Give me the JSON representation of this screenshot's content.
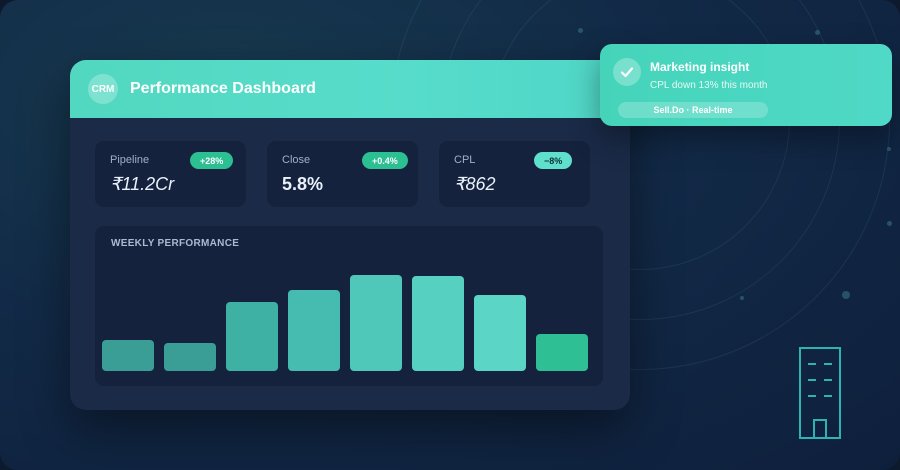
{
  "dashboard": {
    "logo_text": "CRM",
    "title": "Performance Dashboard"
  },
  "metrics": [
    {
      "label": "Pipeline",
      "value": "₹11.2Cr",
      "badge": "+28%"
    },
    {
      "label": "Close",
      "value": "5.8%",
      "badge": "+0.4%"
    },
    {
      "label": "CPL",
      "value": "₹862",
      "badge": "−8%"
    }
  ],
  "chart_data": {
    "type": "bar",
    "title": "WEEKLY PERFORMANCE",
    "categories": [
      "",
      "",
      "",
      "",
      "",
      "",
      "",
      ""
    ],
    "values": [
      31,
      28,
      69,
      81,
      96,
      95,
      76,
      37
    ],
    "ylim": [
      0,
      100
    ],
    "colors": [
      "#3a9e96",
      "#3a9e96",
      "#3fb0a4",
      "#45bcaf",
      "#4fc8b9",
      "#55d0c1",
      "#5bd6c6",
      "#2fbf95"
    ]
  },
  "notification": {
    "title": "Marketing insight",
    "subtitle": "CPL down 13% this month",
    "tag": "Sell.Do · Real-time"
  },
  "theme": {
    "accent": "#4fd8c4",
    "positive": "#2bbf92",
    "card_bg": "#15223d"
  }
}
